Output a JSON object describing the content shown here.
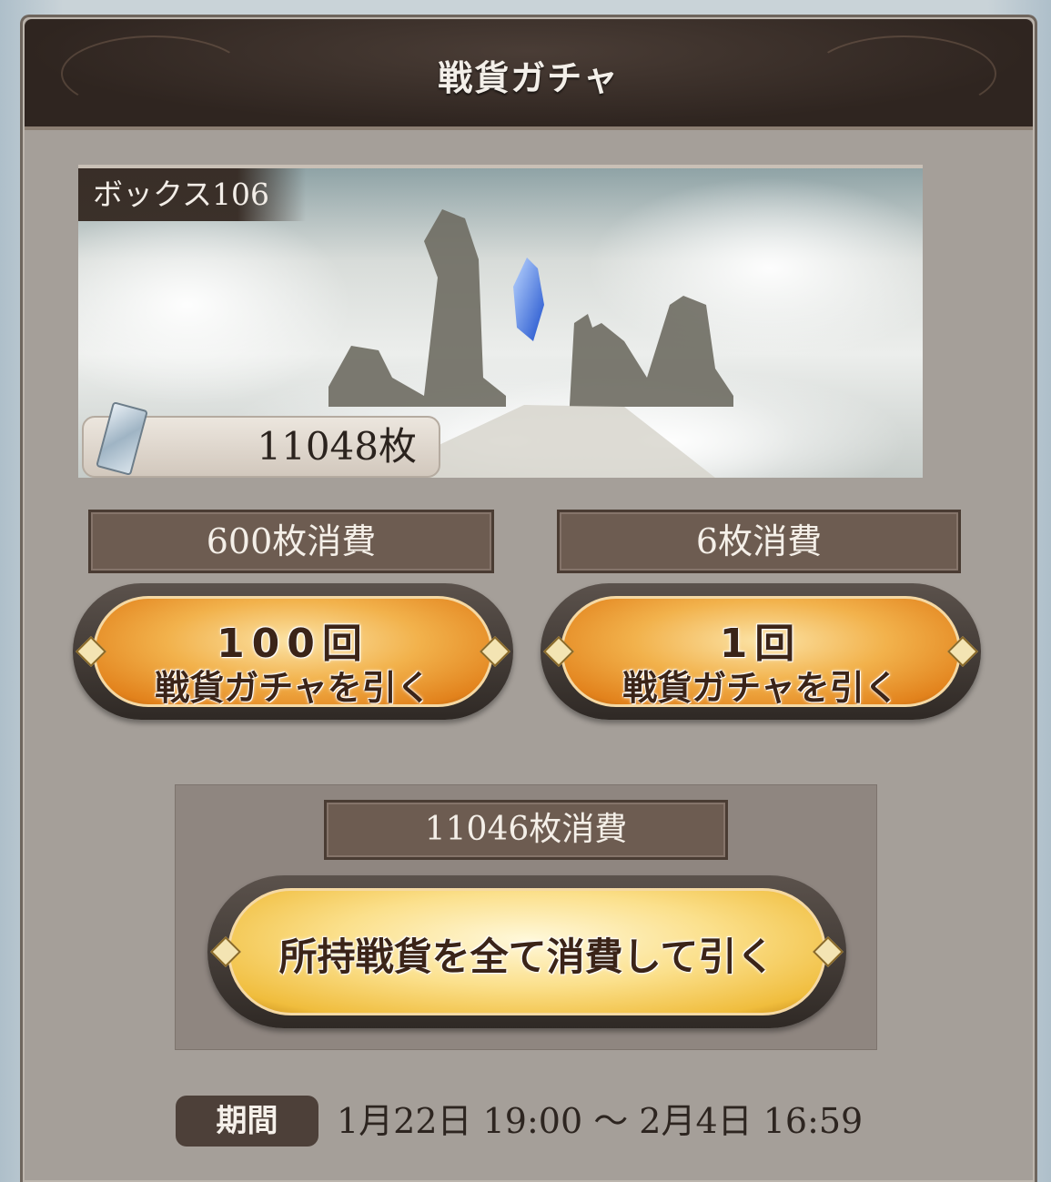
{
  "header": {
    "title": "戦貨ガチャ"
  },
  "box": {
    "label": "ボックス106"
  },
  "tickets": {
    "count_label": "11048枚",
    "icon": "war-ticket-icon"
  },
  "draw_100": {
    "cost": "600枚消費",
    "line1": "100回",
    "line2": "戦貨ガチャを引く"
  },
  "draw_1": {
    "cost": "6枚消費",
    "line1": "1回",
    "line2": "戦貨ガチャを引く"
  },
  "draw_all": {
    "cost": "11046枚消費",
    "label": "所持戦貨を全て消費して引く"
  },
  "period": {
    "label": "期間",
    "value": "1月22日 19:00 〜 2月4日 16:59"
  },
  "colors": {
    "panel": "#a59f99",
    "header": "#2f2520",
    "button_orange": "#f2b24c",
    "button_gold": "#fbe08c"
  }
}
